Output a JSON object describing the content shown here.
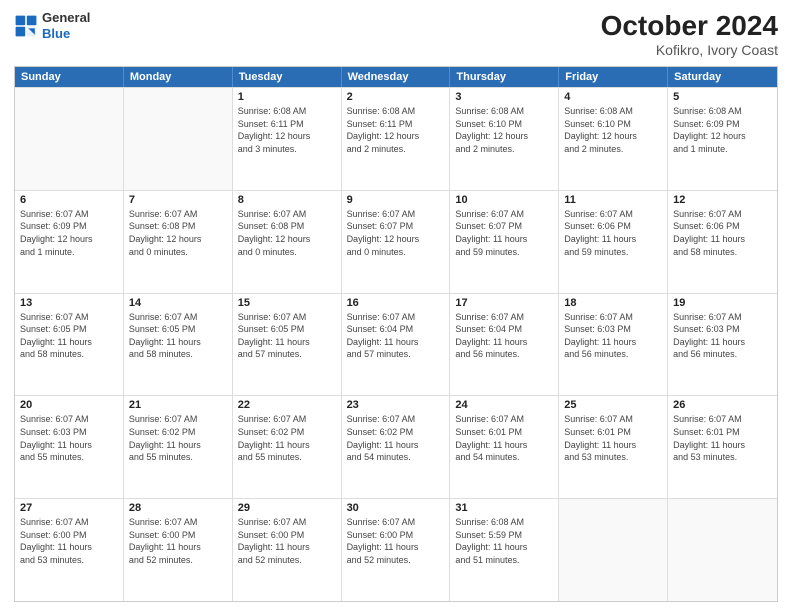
{
  "header": {
    "logo_general": "General",
    "logo_blue": "Blue",
    "title": "October 2024",
    "subtitle": "Kofikro, Ivory Coast"
  },
  "weekdays": [
    "Sunday",
    "Monday",
    "Tuesday",
    "Wednesday",
    "Thursday",
    "Friday",
    "Saturday"
  ],
  "rows": [
    [
      {
        "day": "",
        "lines": [],
        "empty": true
      },
      {
        "day": "",
        "lines": [],
        "empty": true
      },
      {
        "day": "1",
        "lines": [
          "Sunrise: 6:08 AM",
          "Sunset: 6:11 PM",
          "Daylight: 12 hours",
          "and 3 minutes."
        ],
        "empty": false
      },
      {
        "day": "2",
        "lines": [
          "Sunrise: 6:08 AM",
          "Sunset: 6:11 PM",
          "Daylight: 12 hours",
          "and 2 minutes."
        ],
        "empty": false
      },
      {
        "day": "3",
        "lines": [
          "Sunrise: 6:08 AM",
          "Sunset: 6:10 PM",
          "Daylight: 12 hours",
          "and 2 minutes."
        ],
        "empty": false
      },
      {
        "day": "4",
        "lines": [
          "Sunrise: 6:08 AM",
          "Sunset: 6:10 PM",
          "Daylight: 12 hours",
          "and 2 minutes."
        ],
        "empty": false
      },
      {
        "day": "5",
        "lines": [
          "Sunrise: 6:08 AM",
          "Sunset: 6:09 PM",
          "Daylight: 12 hours",
          "and 1 minute."
        ],
        "empty": false
      }
    ],
    [
      {
        "day": "6",
        "lines": [
          "Sunrise: 6:07 AM",
          "Sunset: 6:09 PM",
          "Daylight: 12 hours",
          "and 1 minute."
        ],
        "empty": false
      },
      {
        "day": "7",
        "lines": [
          "Sunrise: 6:07 AM",
          "Sunset: 6:08 PM",
          "Daylight: 12 hours",
          "and 0 minutes."
        ],
        "empty": false
      },
      {
        "day": "8",
        "lines": [
          "Sunrise: 6:07 AM",
          "Sunset: 6:08 PM",
          "Daylight: 12 hours",
          "and 0 minutes."
        ],
        "empty": false
      },
      {
        "day": "9",
        "lines": [
          "Sunrise: 6:07 AM",
          "Sunset: 6:07 PM",
          "Daylight: 12 hours",
          "and 0 minutes."
        ],
        "empty": false
      },
      {
        "day": "10",
        "lines": [
          "Sunrise: 6:07 AM",
          "Sunset: 6:07 PM",
          "Daylight: 11 hours",
          "and 59 minutes."
        ],
        "empty": false
      },
      {
        "day": "11",
        "lines": [
          "Sunrise: 6:07 AM",
          "Sunset: 6:06 PM",
          "Daylight: 11 hours",
          "and 59 minutes."
        ],
        "empty": false
      },
      {
        "day": "12",
        "lines": [
          "Sunrise: 6:07 AM",
          "Sunset: 6:06 PM",
          "Daylight: 11 hours",
          "and 58 minutes."
        ],
        "empty": false
      }
    ],
    [
      {
        "day": "13",
        "lines": [
          "Sunrise: 6:07 AM",
          "Sunset: 6:05 PM",
          "Daylight: 11 hours",
          "and 58 minutes."
        ],
        "empty": false
      },
      {
        "day": "14",
        "lines": [
          "Sunrise: 6:07 AM",
          "Sunset: 6:05 PM",
          "Daylight: 11 hours",
          "and 58 minutes."
        ],
        "empty": false
      },
      {
        "day": "15",
        "lines": [
          "Sunrise: 6:07 AM",
          "Sunset: 6:05 PM",
          "Daylight: 11 hours",
          "and 57 minutes."
        ],
        "empty": false
      },
      {
        "day": "16",
        "lines": [
          "Sunrise: 6:07 AM",
          "Sunset: 6:04 PM",
          "Daylight: 11 hours",
          "and 57 minutes."
        ],
        "empty": false
      },
      {
        "day": "17",
        "lines": [
          "Sunrise: 6:07 AM",
          "Sunset: 6:04 PM",
          "Daylight: 11 hours",
          "and 56 minutes."
        ],
        "empty": false
      },
      {
        "day": "18",
        "lines": [
          "Sunrise: 6:07 AM",
          "Sunset: 6:03 PM",
          "Daylight: 11 hours",
          "and 56 minutes."
        ],
        "empty": false
      },
      {
        "day": "19",
        "lines": [
          "Sunrise: 6:07 AM",
          "Sunset: 6:03 PM",
          "Daylight: 11 hours",
          "and 56 minutes."
        ],
        "empty": false
      }
    ],
    [
      {
        "day": "20",
        "lines": [
          "Sunrise: 6:07 AM",
          "Sunset: 6:03 PM",
          "Daylight: 11 hours",
          "and 55 minutes."
        ],
        "empty": false
      },
      {
        "day": "21",
        "lines": [
          "Sunrise: 6:07 AM",
          "Sunset: 6:02 PM",
          "Daylight: 11 hours",
          "and 55 minutes."
        ],
        "empty": false
      },
      {
        "day": "22",
        "lines": [
          "Sunrise: 6:07 AM",
          "Sunset: 6:02 PM",
          "Daylight: 11 hours",
          "and 55 minutes."
        ],
        "empty": false
      },
      {
        "day": "23",
        "lines": [
          "Sunrise: 6:07 AM",
          "Sunset: 6:02 PM",
          "Daylight: 11 hours",
          "and 54 minutes."
        ],
        "empty": false
      },
      {
        "day": "24",
        "lines": [
          "Sunrise: 6:07 AM",
          "Sunset: 6:01 PM",
          "Daylight: 11 hours",
          "and 54 minutes."
        ],
        "empty": false
      },
      {
        "day": "25",
        "lines": [
          "Sunrise: 6:07 AM",
          "Sunset: 6:01 PM",
          "Daylight: 11 hours",
          "and 53 minutes."
        ],
        "empty": false
      },
      {
        "day": "26",
        "lines": [
          "Sunrise: 6:07 AM",
          "Sunset: 6:01 PM",
          "Daylight: 11 hours",
          "and 53 minutes."
        ],
        "empty": false
      }
    ],
    [
      {
        "day": "27",
        "lines": [
          "Sunrise: 6:07 AM",
          "Sunset: 6:00 PM",
          "Daylight: 11 hours",
          "and 53 minutes."
        ],
        "empty": false
      },
      {
        "day": "28",
        "lines": [
          "Sunrise: 6:07 AM",
          "Sunset: 6:00 PM",
          "Daylight: 11 hours",
          "and 52 minutes."
        ],
        "empty": false
      },
      {
        "day": "29",
        "lines": [
          "Sunrise: 6:07 AM",
          "Sunset: 6:00 PM",
          "Daylight: 11 hours",
          "and 52 minutes."
        ],
        "empty": false
      },
      {
        "day": "30",
        "lines": [
          "Sunrise: 6:07 AM",
          "Sunset: 6:00 PM",
          "Daylight: 11 hours",
          "and 52 minutes."
        ],
        "empty": false
      },
      {
        "day": "31",
        "lines": [
          "Sunrise: 6:08 AM",
          "Sunset: 5:59 PM",
          "Daylight: 11 hours",
          "and 51 minutes."
        ],
        "empty": false
      },
      {
        "day": "",
        "lines": [],
        "empty": true
      },
      {
        "day": "",
        "lines": [],
        "empty": true
      }
    ]
  ]
}
